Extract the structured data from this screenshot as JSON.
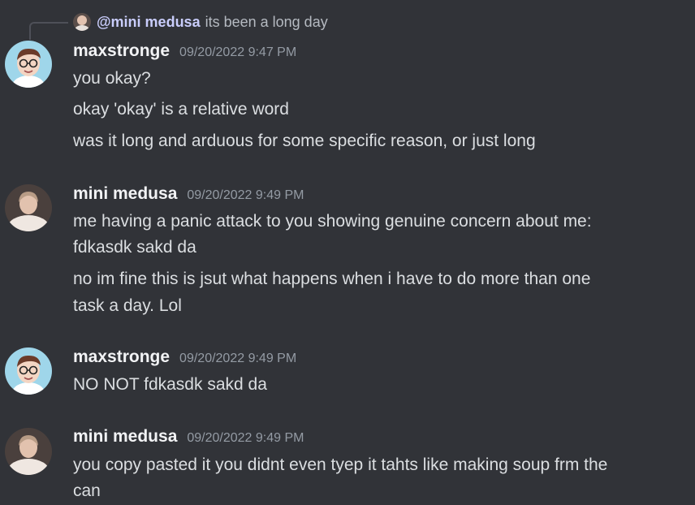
{
  "reply": {
    "author": "@mini medusa",
    "text": "its been a long day"
  },
  "messages": [
    {
      "author": "maxstronge",
      "timestamp": "09/20/2022 9:47 PM",
      "lines": [
        "you okay?",
        "okay 'okay' is a relative word",
        "was it long and arduous for some specific reason, or just long"
      ]
    },
    {
      "author": "mini medusa",
      "timestamp": "09/20/2022 9:49 PM",
      "lines": [
        "me having a panic attack to you showing genuine concern about me:",
        "fdkasdk sakd da",
        "no im fine this is jsut what happens when i have to do more than one",
        "task a day. Lol"
      ]
    },
    {
      "author": "maxstronge",
      "timestamp": "09/20/2022 9:49 PM",
      "lines": [
        "NO NOT fdkasdk sakd da"
      ]
    },
    {
      "author": "mini medusa",
      "timestamp": "09/20/2022 9:49 PM",
      "lines": [
        "you copy pasted it you didnt even tyep it tahts like making soup frm the",
        "can"
      ]
    }
  ],
  "colors": {
    "background": "#313338",
    "message_text": "#dbdee1",
    "author_name": "#f2f3f5",
    "timestamp": "#949ba4",
    "reply_author": "#c9cdfb",
    "reply_text": "#b5bac1"
  }
}
